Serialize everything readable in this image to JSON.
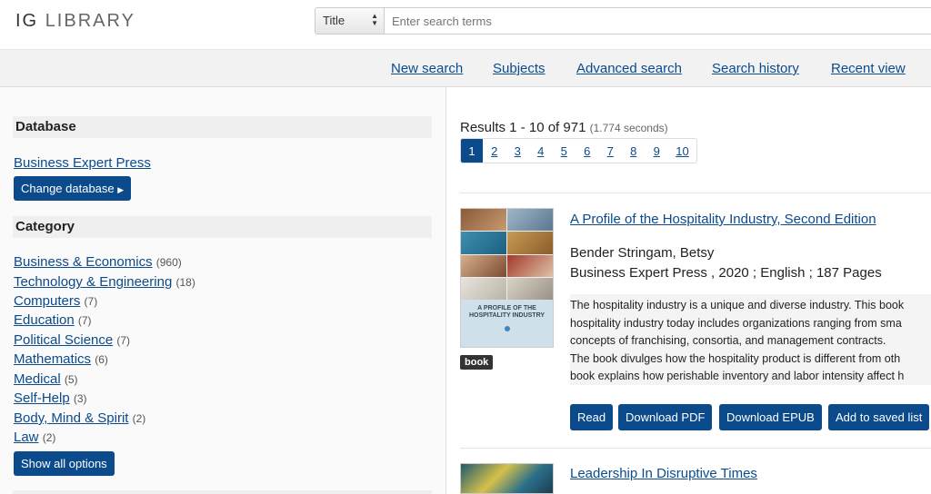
{
  "header": {
    "logo_part1": "IG",
    "logo_part2": "LIBRARY",
    "search": {
      "field_select": "Title",
      "placeholder": "Enter search terms"
    }
  },
  "nav": {
    "links": [
      "New search",
      "Subjects",
      "Advanced search",
      "Search history",
      "Recent view"
    ]
  },
  "sidebar": {
    "database_heading": "Database",
    "database_name": "Business Expert Press",
    "change_database": "Change database",
    "category_heading": "Category",
    "categories": [
      {
        "label": "Business & Economics",
        "count": "(960)"
      },
      {
        "label": "Technology & Engineering",
        "count": "(18)"
      },
      {
        "label": "Computers",
        "count": "(7)"
      },
      {
        "label": "Education",
        "count": "(7)"
      },
      {
        "label": "Political Science",
        "count": "(7)"
      },
      {
        "label": "Mathematics",
        "count": "(6)"
      },
      {
        "label": "Medical",
        "count": "(5)"
      },
      {
        "label": "Self-Help",
        "count": "(3)"
      },
      {
        "label": "Body, Mind & Spirit",
        "count": "(2)"
      },
      {
        "label": "Law",
        "count": "(2)"
      }
    ],
    "show_all": "Show all options"
  },
  "results": {
    "summary": "Results 1 - 10 of 971",
    "time": "(1.774 seconds)",
    "pages": [
      "1",
      "2",
      "3",
      "4",
      "5",
      "6",
      "7",
      "8",
      "9",
      "10"
    ],
    "active_page": "1",
    "items": [
      {
        "title": "A Profile of the Hospitality Industry, Second Edition",
        "author": "Bender Stringam, Betsy",
        "pubinfo": "Business Expert Press , 2020 ; English ; 187 Pages",
        "type_badge": "book",
        "cover_text": "A PROFILE OF THE HOSPITALITY INDUSTRY",
        "abstract_lines": [
          "The hospitality industry is a unique and diverse industry. This book",
          "hospitality industry today includes organizations ranging from sma",
          "concepts of franchising, consortia, and management contracts.",
          "The book divulges how the hospitality product is different from oth",
          "book explains how perishable inventory and labor intensity affect h"
        ],
        "actions": [
          "Read",
          "Download PDF",
          "Download EPUB",
          "Add to saved list"
        ]
      },
      {
        "title": "Leadership In Disruptive Times"
      }
    ]
  },
  "colors": {
    "accent": "#0b4a8b",
    "badge": "#333333"
  }
}
